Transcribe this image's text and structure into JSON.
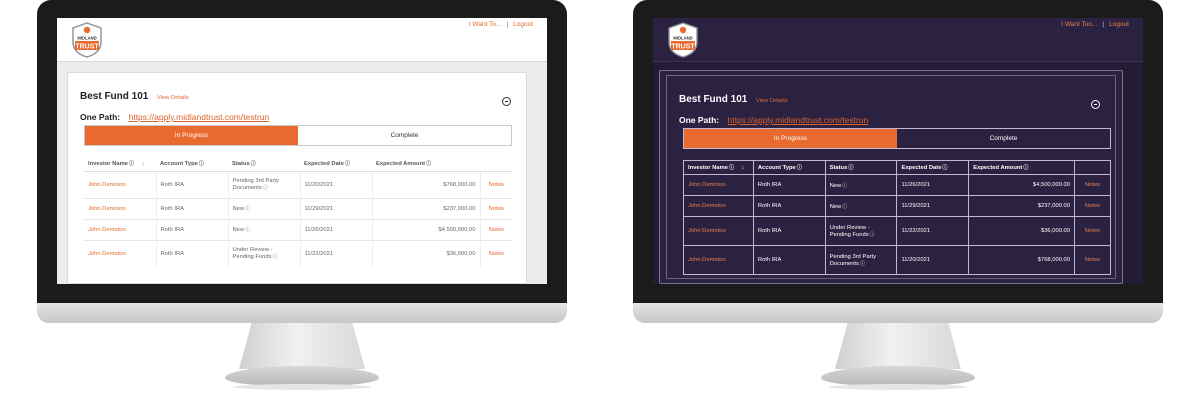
{
  "brand": {
    "logo_text_top": "MIDLAND",
    "logo_text_bottom": "TRUST",
    "accent": "#e86a2e",
    "dark_background": "#2b2140"
  },
  "header": {
    "links": [
      "I Want To...",
      "Logout"
    ],
    "separator": "|"
  },
  "fund": {
    "title": "Best Fund 101",
    "view_details": "View Details",
    "path_label": "One Path:",
    "path_url": "https://apply.midlandtrust.com/testrun"
  },
  "tabs": [
    {
      "label": "In Progress",
      "active": true
    },
    {
      "label": "Complete",
      "active": false
    }
  ],
  "table": {
    "columns": [
      "Investor Name",
      "Account Type",
      "Status",
      "Expected Date",
      "Expected Amount",
      ""
    ],
    "sort_icon": "arrow-down-icon",
    "info_icon": "info-circle-icon"
  },
  "light_screen": {
    "rows": [
      {
        "name": "John Demotoo",
        "type": "Roth IRA",
        "status_line1": "Pending 3rd Party",
        "status_line2": "Documents",
        "date": "11/20/2021",
        "amount": "$768,000.00",
        "notes": "Notes"
      },
      {
        "name": "John Demotoo",
        "type": "Roth IRA",
        "status_line1": "New",
        "status_line2": "",
        "date": "11/29/2021",
        "amount": "$237,000.00",
        "notes": "Notes"
      },
      {
        "name": "John Demotoo",
        "type": "Roth IRA",
        "status_line1": "New",
        "status_line2": "",
        "date": "11/26/2021",
        "amount": "$4,500,000.00",
        "notes": "Notes"
      },
      {
        "name": "John Demotoo",
        "type": "Roth IRA",
        "status_line1": "Under Review -",
        "status_line2": "Pending Funds",
        "date": "11/22/2021",
        "amount": "$36,000.00",
        "notes": "Notes"
      }
    ]
  },
  "dark_screen": {
    "links": [
      "I Want Too...",
      "Logout"
    ],
    "rows": [
      {
        "name": "John Demotoo",
        "type": "Roth IRA",
        "status_line1": "New",
        "status_line2": "",
        "date": "11/26/2021",
        "amount": "$4,500,000.00",
        "notes": "Notes"
      },
      {
        "name": "John Demotoo",
        "type": "Roth IRA",
        "status_line1": "New",
        "status_line2": "",
        "date": "11/29/2021",
        "amount": "$237,000.00",
        "notes": "Notes"
      },
      {
        "name": "John Demotoo",
        "type": "Roth IRA",
        "status_line1": "Under Review -",
        "status_line2": "Pending Funds",
        "date": "11/22/2021",
        "amount": "$36,000.00",
        "notes": "Notes"
      },
      {
        "name": "John Demotoo",
        "type": "Roth IRA",
        "status_line1": "Pending 3rd Party",
        "status_line2": "Documents",
        "date": "11/20/2021",
        "amount": "$768,000.00",
        "notes": "Notes"
      }
    ]
  }
}
